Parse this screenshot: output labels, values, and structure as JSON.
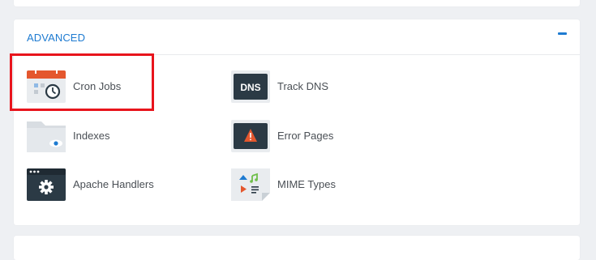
{
  "section": {
    "title": "ADVANCED",
    "collapse_icon": "minus-icon"
  },
  "tools": [
    {
      "label": "Cron Jobs",
      "icon": "calendar-clock-icon"
    },
    {
      "label": "Track DNS",
      "icon": "dns-icon",
      "icon_text": "DNS"
    },
    {
      "label": "Indexes",
      "icon": "folder-eye-icon"
    },
    {
      "label": "Error Pages",
      "icon": "warning-icon"
    },
    {
      "label": "Apache Handlers",
      "icon": "window-gear-icon"
    },
    {
      "label": "MIME Types",
      "icon": "file-media-icon"
    }
  ],
  "colors": {
    "accent": "#1e7bd1",
    "highlight": "#e8141c",
    "icon_dark": "#2b3a45",
    "calendar_red": "#e4572e"
  }
}
